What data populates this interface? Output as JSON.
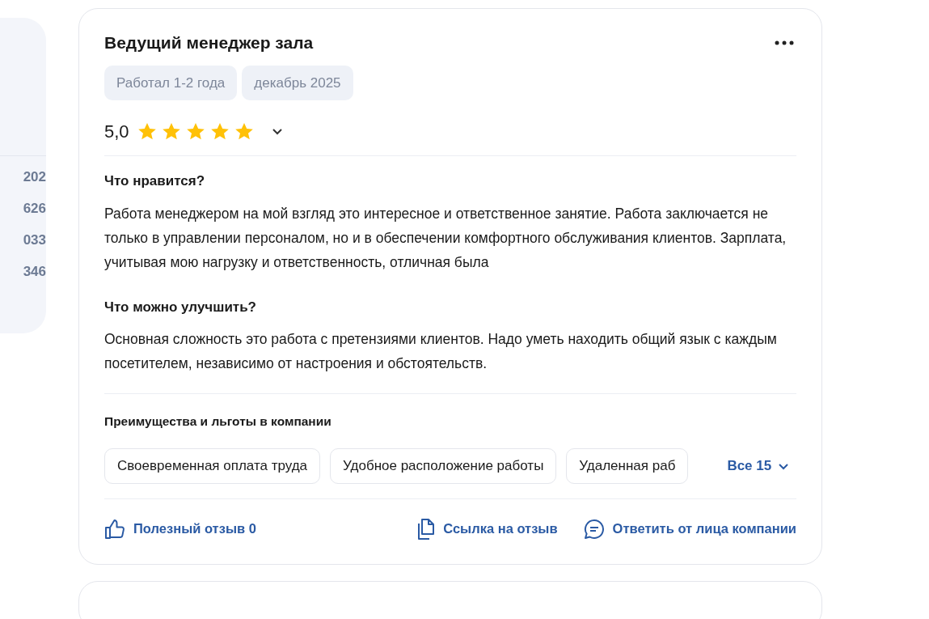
{
  "side_panel": {
    "numbers": [
      "202",
      "626",
      "033",
      "346"
    ]
  },
  "review": {
    "title": "Ведущий менеджер зала",
    "tags": [
      "Работал 1-2 года",
      "декабрь 2025"
    ],
    "rating": "5,0",
    "stars": 5,
    "sections": [
      {
        "heading": "Что нравится?",
        "text": "Работа менеджером на мой взгляд это интересное и ответственное занятие. Работа заключается не только в управлении персоналом, но и в обеспечении комфортного обслуживания клиентов. Зарплата, учитывая мою нагрузку и ответственность, отличная была"
      },
      {
        "heading": "Что можно улучшить?",
        "text": "Основная сложность это работа с претензиями клиентов. Надо уметь находить общий язык с каждым посетителем, независимо от настроения и обстоятельств."
      }
    ],
    "benefits": {
      "heading": "Преимущества и льготы в компании",
      "items": [
        "Своевременная оплата труда",
        "Удобное расположение работы",
        "Удаленная раб"
      ],
      "more": "Все 15"
    },
    "actions": [
      {
        "kind": "like",
        "label": "Полезный отзыв 0"
      },
      {
        "kind": "link",
        "label": "Ссылка на отзыв"
      },
      {
        "kind": "reply",
        "label": "Ответить от лица компании"
      }
    ]
  }
}
